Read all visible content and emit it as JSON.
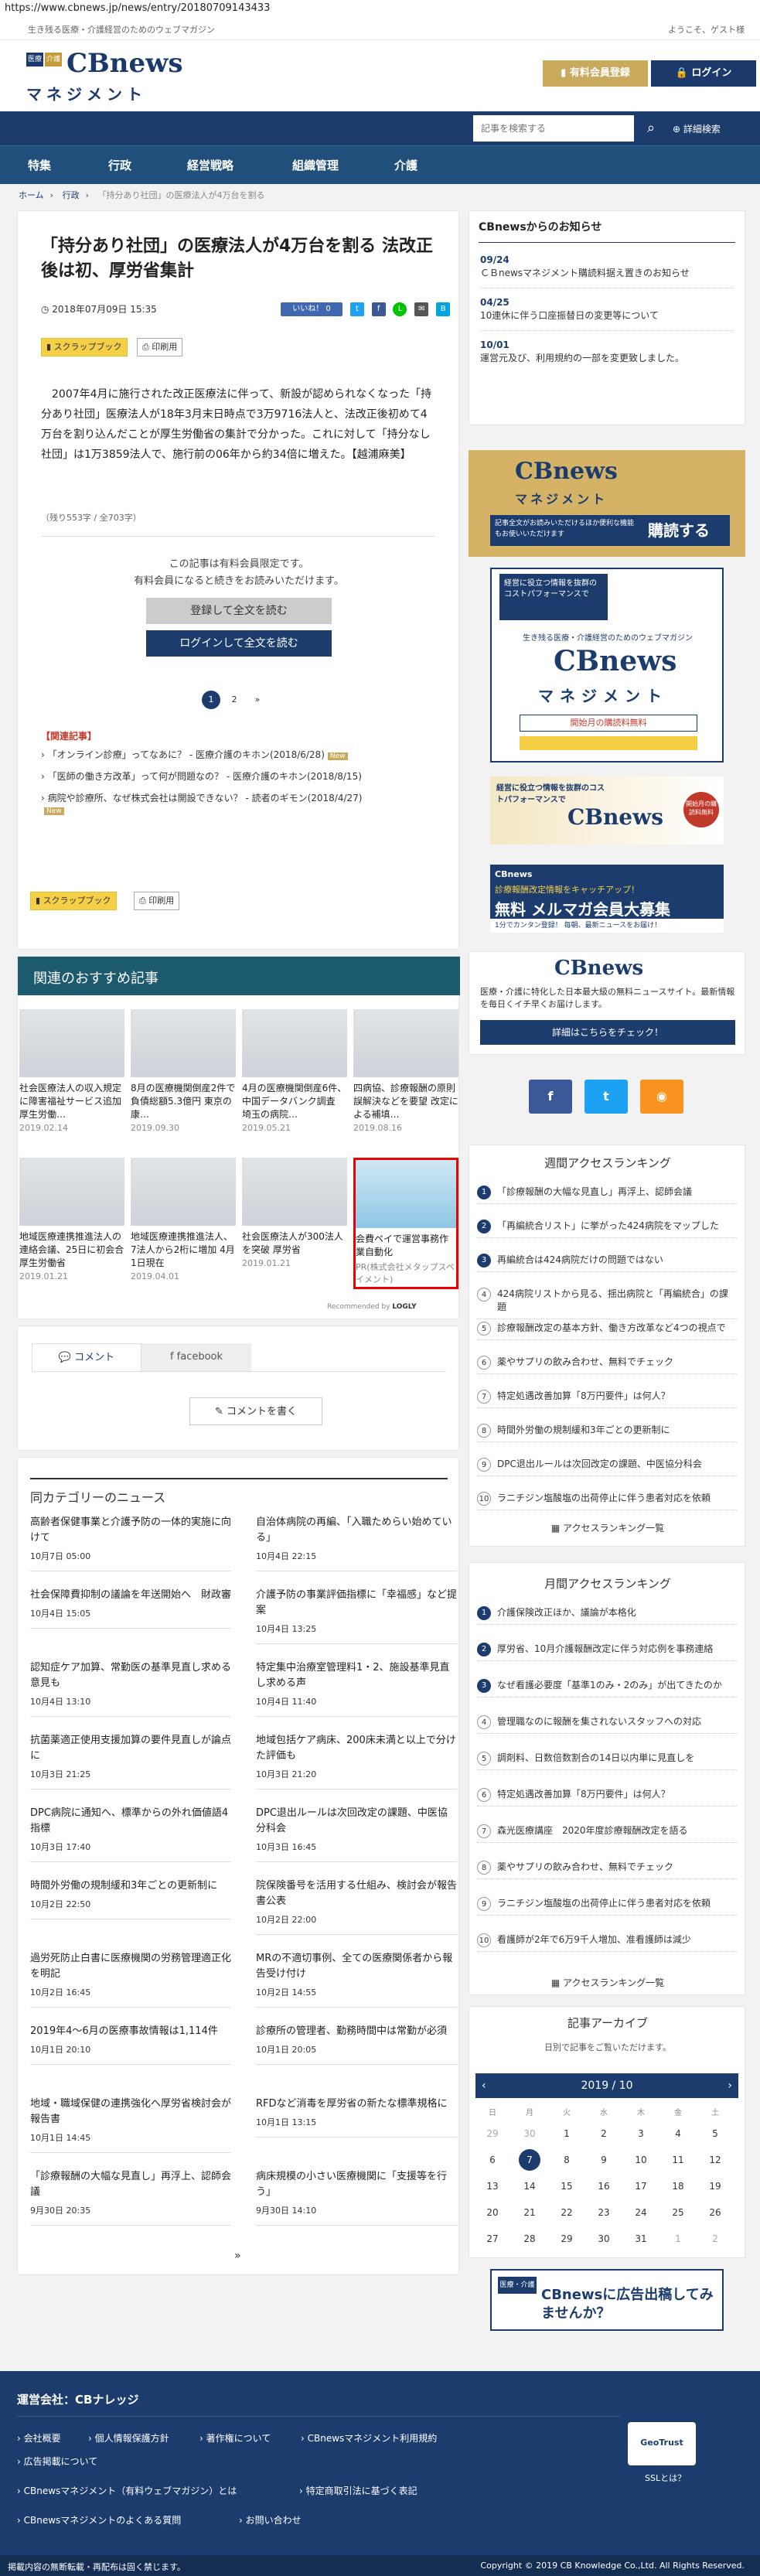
{
  "url": "https://www.cbnews.jp/news/entry/20180709143433",
  "topbar": {
    "tagline": "生き残る医療・介護経営のためのウェブマガジン",
    "guest": "ようこそ、ゲスト様"
  },
  "logo": {
    "med": "医療",
    "care": "介護",
    "name": "CBnews",
    "sub": "マネジメント"
  },
  "header": {
    "register": "有料会員登録",
    "login": "ログイン"
  },
  "search": {
    "placeholder": "記事を検索する",
    "advanced": "詳細検索"
  },
  "nav": [
    "特集",
    "行政",
    "経営戦略",
    "組織管理",
    "介護"
  ],
  "breadcrumb": [
    "ホーム",
    "行政",
    "「持分あり社団」の医療法人が4万台を割る"
  ],
  "article": {
    "title": "「持分あり社団」の医療法人が4万台を割る 法改正後は初、厚労省集計",
    "date": "2018年07月09日 15:35",
    "like": "いいね！ 0",
    "scrap": "スクラップブック",
    "print": "印刷用",
    "body": "2007年4月に施行された改正医療法に伴って、新設が認められなくなった「持分あり社団」医療法人が18年3月末日時点で3万9716法人と、法改正後初めて4万台を割り込んだことが厚生労働省の集計で分かった。これに対して「持分なし社団」は1万3859法人で、施行前の06年から約34倍に増えた。【越浦麻美】",
    "count": "（残り553字 / 全703字）",
    "member_note1": "この記事は有料会員限定です。",
    "member_note2": "有料会員になると続きをお読みいただけます。",
    "register_btn": "登録して全文を読む",
    "login_btn": "ログインして全文を読む",
    "pages": [
      "1",
      "2",
      "»"
    ],
    "related_head": "【関連記事】",
    "related": [
      "「オンライン診療」ってなあに？ - 医療介護のキホン(2018/6/28)",
      "「医師の働き方改革」って何が問題なの？ - 医療介護のキホン(2018/8/15)",
      "病院や診療所、なぜ株式会社は開設できない？ - 読者のギモン(2018/4/27)"
    ],
    "new": "New"
  },
  "recommend": {
    "heading": "関連のおすすめ記事",
    "recommended_by": "Recommended by",
    "logly": "LOGLY",
    "cards": [
      {
        "title": "社会医療法人の収入規定に障害福祉サービス追加 厚生労働…",
        "date": "2019.02.14"
      },
      {
        "title": "8月の医療機関倒産2件で負債総額5.3億円 東京の康…",
        "date": "2019.09.30"
      },
      {
        "title": "4月の医療機関倒産6件、中国データバンク調査 埼玉の病院…",
        "date": "2019.05.21"
      },
      {
        "title": "四病協、診療報酬の原則誤解決などを要望 改定による補填…",
        "date": "2019.08.16"
      },
      {
        "title": "地域医療連携推進法人の連絡会議、25日に初会合 厚生労働省",
        "date": "2019.01.21"
      },
      {
        "title": "地域医療連携推進法人、7法人から2桁に増加 4月1日現在",
        "date": "2019.04.01"
      },
      {
        "title": "社会医療法人が300法人を突破 厚労省",
        "date": "2019.01.21"
      },
      {
        "title": "会費ペイで運営事務作業自動化",
        "date": "PR(株式会社メタップスペイメント)"
      }
    ]
  },
  "comments": {
    "tab_comment": "コメント",
    "tab_facebook": "facebook",
    "write": "コメントを書く"
  },
  "category_news": {
    "heading": "同カテゴリーのニュース",
    "items": [
      {
        "title": "高齢者保健事業と介護予防の一体的実施に向けて",
        "time": "10月7日 05:00"
      },
      {
        "title": "自治体病院の再編、「入職ためらい始めている」",
        "time": "10月4日 22:15"
      },
      {
        "title": "社会保障費抑制の議論を年送開始へ　財政審",
        "time": "10月4日 15:05"
      },
      {
        "title": "介護予防の事業評価指標に「幸福感」など提案",
        "time": "10月4日 13:25"
      },
      {
        "title": "認知症ケア加算、常勤医の基準見直し求める意見も",
        "time": "10月4日 13:10"
      },
      {
        "title": "特定集中治療室管理料1・2、施設基準見直し求める声",
        "time": "10月4日 11:40"
      },
      {
        "title": "抗菌薬適正使用支援加算の要件見直しが論点に",
        "time": "10月3日 21:25"
      },
      {
        "title": "地域包括ケア病床、200床未満と以上で分けた評価も",
        "time": "10月3日 21:20"
      },
      {
        "title": "DPC病院に通知へ、標準からの外れ価値語4指標",
        "time": "10月3日 17:40"
      },
      {
        "title": "DPC退出ルールは次回改定の課題、中医協分科会",
        "time": "10月3日 16:45"
      },
      {
        "title": "時間外労働の規制緩和3年ごとの更新制に",
        "time": "10月2日 22:50"
      },
      {
        "title": "院保険番号を活用する仕組み、検討会が報告書公表",
        "time": "10月2日 22:00"
      },
      {
        "title": "過労死防止白書に医療機関の労務管理適正化を明記",
        "time": "10月2日 16:45"
      },
      {
        "title": "MRの不適切事例、全ての医療関係者から報告受け付け",
        "time": "10月2日 14:55"
      },
      {
        "title": "2019年4～6月の医療事故情報は1,114件",
        "time": "10月1日 20:10"
      },
      {
        "title": "診療所の管理者、勤務時間中は常勤が必須",
        "time": "10月1日 20:05"
      },
      {
        "title": "地域・職域保健の連携強化へ厚労省検討会が報告書",
        "time": "10月1日 14:45"
      },
      {
        "title": "RFDなど消毒を厚労省の新たな標準規格に",
        "time": "10月1日 13:15"
      },
      {
        "title": "「診療報酬の大幅な見直し」再浮上、認師会議",
        "time": "9月30日 20:35"
      },
      {
        "title": "病床規模の小さい医療機関に「支援等を行う」",
        "time": "9月30日 14:10"
      }
    ],
    "more": "»"
  },
  "sidebar": {
    "info_head": "CBnewsからのお知らせ",
    "info": [
      {
        "date": "09/24",
        "text": "ＣＢnewsマネジメント購読料据え置きのお知らせ"
      },
      {
        "date": "04/25",
        "text": "10連休に伴う口座振替日の変更等について"
      },
      {
        "date": "10/01",
        "text": "運営元及び、利用規約の一部を変更致しました。"
      }
    ],
    "ad1_note": "記事全文がお読みいただけるほか便利な機能もお使いいただけます",
    "ad1_cta": "購読する",
    "ad2_top": "経営に役立つ情報を抜群のコストパフォーマンスで",
    "ad2_mid": "生き残る医療・介護経営のためのウェブマガジン",
    "ad2_cta": "開始月の購読料無料",
    "ad3_text": "経営に役立つ情報を抜群のコストパフォーマンスで",
    "ad3_badge": "開始月の購読料無料",
    "ad4_top": "診療報酬改定情報をキャッチアップ！",
    "ad4_main": "無料 メルマガ会員大募集",
    "ad4_sub": "1分でカンタン登録！ 毎朝、最新ニュースをお届け！",
    "ad5_text": "医療・介護に特化した日本最大級の無料ニュースサイト。最新情報を毎日くイチ早くお届けします。",
    "ad5_btn": "詳細はこちらをチェック！",
    "sns": [
      "f",
      "t",
      "rss"
    ],
    "weekly_head": "週間アクセスランキング",
    "weekly": [
      "「診療報酬の大幅な見直し」再浮上、認師会議",
      "「再編統合リスト」に挙がった424病院をマップした",
      "再編統合は424病院だけの問題ではない",
      "424病院リストから見る、揺出病院と「再編統合」の課題",
      "診療報酬改定の基本方針、働き方改革など4つの視点で",
      "薬やサプリの飲み合わせ、無料でチェック",
      "特定処遇改善加算「8万円要件」は何人？",
      "時間外労働の規制緩和3年ごとの更新制に",
      "DPC退出ルールは次回改定の課題、中医協分科会",
      "ラニチジン塩酸塩の出荷停止に伴う患者対応を依頼"
    ],
    "monthly_head": "月間アクセスランキング",
    "monthly": [
      "介護保険改正ほか、議論が本格化",
      "厚労省、10月介護報酬改定に伴う対応例を事務連絡",
      "なぜ看護必要度「基準1のみ・2のみ」が出てきたのか",
      "管理職なのに報酬を集されないスタッフへの対応",
      "調剤料、日数倍数割合の14日以内単に見直しを",
      "特定処遇改善加算「8万円要件」は何人？",
      "森光医療講座　2020年度診療報酬改定を語る",
      "薬やサプリの飲み合わせ、無料でチェック",
      "ラニチジン塩酸塩の出荷停止に伴う患者対応を依頼",
      "看護師が2年で6万9千人増加、准看護師は減少"
    ],
    "ranking_more": "アクセスランキング一覧",
    "archive_head": "記事アーカイブ",
    "archive_note": "日別で記事をご覧いただけます。",
    "month": "2019 / 10",
    "weekdays": [
      "日",
      "月",
      "火",
      "水",
      "木",
      "金",
      "土"
    ],
    "days": [
      "29",
      "30",
      "1",
      "2",
      "3",
      "4",
      "5",
      "6",
      "7",
      "8",
      "9",
      "10",
      "11",
      "12",
      "13",
      "14",
      "15",
      "16",
      "17",
      "18",
      "19",
      "20",
      "21",
      "22",
      "23",
      "24",
      "25",
      "26",
      "27",
      "28",
      "29",
      "30",
      "31",
      "1",
      "2"
    ],
    "ad6": "CBnewsに広告出稿してみませんか？",
    "ad6_top": "医療・介護"
  },
  "footer": {
    "company": "運営会社：CBナレッジ",
    "links1": [
      "会社概要",
      "個人情報保護方針",
      "著作権について",
      "CBnewsマネジメント利用規約"
    ],
    "links2": [
      "広告掲載について"
    ],
    "links3": [
      "CBnewsマネジメント（有料ウェブマガジン）とは",
      "特定商取引法に基づく表記"
    ],
    "links4": [
      "CBnewsマネジメントのよくある質問",
      "お問い合わせ"
    ],
    "ssl": "SSLとは？",
    "geotrust": "GeoTrust"
  },
  "copyright": {
    "left": "掲載内容の無断転載・再配布は固く禁じます。",
    "right": "Copyright © 2019 CB Knowledge Co.,Ltd. All Rights Reserved."
  }
}
